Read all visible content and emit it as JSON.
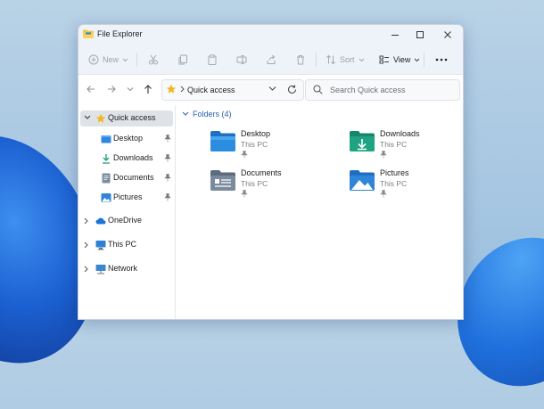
{
  "window": {
    "title": "File Explorer"
  },
  "toolbar": {
    "new_label": "New",
    "sort_label": "Sort",
    "view_label": "View"
  },
  "address": {
    "path": "Quick access"
  },
  "search": {
    "placeholder": "Search Quick access"
  },
  "sidebar": {
    "items": [
      {
        "label": "Quick access",
        "icon": "star-icon"
      },
      {
        "label": "Desktop",
        "icon": "desktop-icon",
        "pinned": true
      },
      {
        "label": "Downloads",
        "icon": "download-icon",
        "pinned": true
      },
      {
        "label": "Documents",
        "icon": "documents-icon",
        "pinned": true
      },
      {
        "label": "Pictures",
        "icon": "pictures-icon",
        "pinned": true
      },
      {
        "label": "OneDrive",
        "icon": "cloud-icon"
      },
      {
        "label": "This PC",
        "icon": "computer-icon"
      },
      {
        "label": "Network",
        "icon": "network-icon"
      }
    ]
  },
  "content": {
    "group_header": "Folders (4)",
    "folders": [
      {
        "name": "Desktop",
        "location": "This PC"
      },
      {
        "name": "Downloads",
        "location": "This PC"
      },
      {
        "name": "Documents",
        "location": "This PC"
      },
      {
        "name": "Pictures",
        "location": "This PC"
      }
    ]
  },
  "colors": {
    "accent": "#2a5fb0",
    "folder_blue": "#2b8de0",
    "folder_teal": "#1fa383",
    "star": "#f2b61b"
  }
}
